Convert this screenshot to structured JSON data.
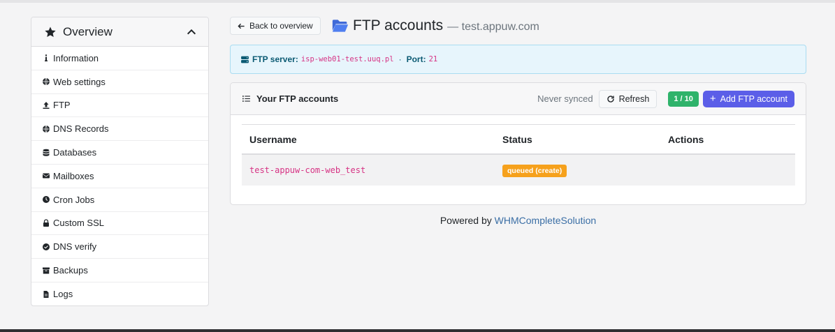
{
  "sidebar": {
    "title": "Overview",
    "items": [
      {
        "label": "Information",
        "icon": "info-icon"
      },
      {
        "label": "Web settings",
        "icon": "globe-icon"
      },
      {
        "label": "FTP",
        "icon": "upload-arrow-icon"
      },
      {
        "label": "DNS Records",
        "icon": "globe-icon"
      },
      {
        "label": "Databases",
        "icon": "database-icon"
      },
      {
        "label": "Mailboxes",
        "icon": "envelope-icon"
      },
      {
        "label": "Cron Jobs",
        "icon": "clock-icon"
      },
      {
        "label": "Custom SSL",
        "icon": "lock-icon"
      },
      {
        "label": "DNS verify",
        "icon": "check-circle-icon"
      },
      {
        "label": "Backups",
        "icon": "archive-icon"
      },
      {
        "label": "Logs",
        "icon": "file-icon"
      }
    ]
  },
  "header": {
    "back_label": "Back to overview",
    "title": "FTP accounts",
    "subtitle": "— test.appuw.com"
  },
  "alert": {
    "server_label": "FTP server:",
    "server_value": "isp-web01-test.uuq.pl",
    "separator": "·",
    "port_label": "Port:",
    "port_value": "21"
  },
  "card": {
    "title": "Your FTP accounts",
    "sync_status": "Never synced",
    "refresh_label": "Refresh",
    "count_badge": "1 / 10",
    "add_label": "Add FTP account",
    "columns": [
      "Username",
      "Status",
      "Actions"
    ],
    "rows": [
      {
        "username": "test-appuw-com-web_test",
        "status": "queued (create)"
      }
    ]
  },
  "footer": {
    "prefix": "Powered by",
    "link": "WHMCompleteSolution"
  },
  "colors": {
    "accent": "#5b5ee8",
    "success": "#2fb36b",
    "warning": "#f6a11c",
    "code": "#d63384"
  }
}
